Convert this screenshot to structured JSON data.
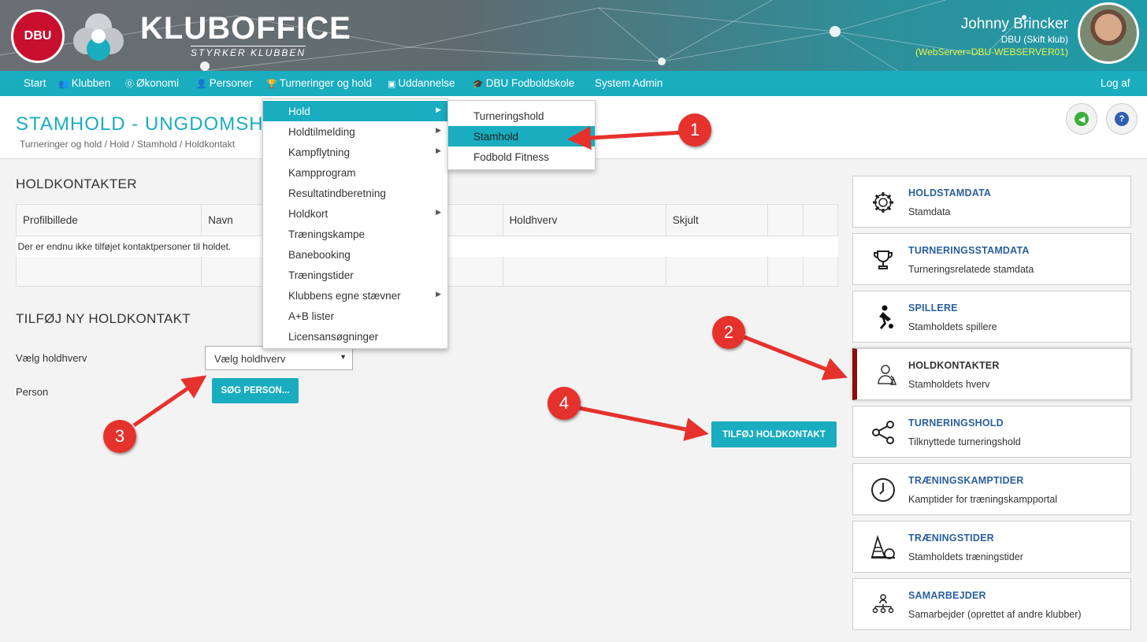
{
  "header": {
    "logo_text": "DBU",
    "brand": "KLUBOFFICE",
    "brand_sub": "STYRKER KLUBBEN",
    "user_name": "Johnny Brincker",
    "user_club": "DBU (Skift klub)",
    "user_server": "(WebServer=DBU-WEBSERVER01)"
  },
  "nav": {
    "items": [
      "Start",
      "Klubben",
      "Økonomi",
      "Personer",
      "Turneringer og hold",
      "Uddannelse",
      "DBU Fodboldskole",
      "System Admin"
    ],
    "logout": "Log af"
  },
  "page": {
    "title": "STAMHOLD - UNGDOMSH",
    "breadcrumb": "Turneringer og hold / Hold / Stamhold / Holdkontakt"
  },
  "holdkontakter": {
    "title": "HOLDKONTAKTER",
    "columns": [
      "Profilbillede",
      "Navn",
      "",
      "Holdhverv",
      "Skjult",
      "",
      ""
    ],
    "empty_message": "Der er endnu ikke tilføjet kontaktpersoner til holdet."
  },
  "add_form": {
    "title": "TILFØJ NY HOLDKONTAKT",
    "role_label": "Vælg holdhverv",
    "role_value": "Vælg holdhverv",
    "person_label": "Person",
    "search_button": "SØG PERSON...",
    "add_button": "TILFØJ HOLDKONTAKT"
  },
  "menu": {
    "items": [
      {
        "label": "Hold",
        "sub": true
      },
      {
        "label": "Holdtilmelding",
        "sub": true
      },
      {
        "label": "Kampflytning",
        "sub": true
      },
      {
        "label": "Kampprogram",
        "sub": false
      },
      {
        "label": "Resultatindberetning",
        "sub": false
      },
      {
        "label": "Holdkort",
        "sub": true
      },
      {
        "label": "Træningskampe",
        "sub": false
      },
      {
        "label": "Banebooking",
        "sub": false
      },
      {
        "label": "Træningstider",
        "sub": false
      },
      {
        "label": "Klubbens egne stævner",
        "sub": true
      },
      {
        "label": "A+B lister",
        "sub": false
      },
      {
        "label": "Licensansøgninger",
        "sub": false
      }
    ],
    "submenu": [
      "Turneringshold",
      "Stamhold",
      "Fodbold Fitness"
    ]
  },
  "cards": [
    {
      "title": "HOLDSTAMDATA",
      "sub": "Stamdata",
      "icon": "gear-icon"
    },
    {
      "title": "TURNERINGSSTAMDATA",
      "sub": "Turneringsrelatede stamdata",
      "icon": "trophy-icon"
    },
    {
      "title": "SPILLERE",
      "sub": "Stamholdets spillere",
      "icon": "player-icon"
    },
    {
      "title": "HOLDKONTAKTER",
      "sub": "Stamholdets hverv",
      "icon": "contact-icon"
    },
    {
      "title": "TURNERINGSHOLD",
      "sub": "Tilknyttede turneringshold",
      "icon": "share-icon"
    },
    {
      "title": "TRÆNINGSKAMPTIDER",
      "sub": "Kamptider for træningskampportal",
      "icon": "clock-icon"
    },
    {
      "title": "TRÆNINGSTIDER",
      "sub": "Stamholdets træningstider",
      "icon": "cone-ball-icon"
    },
    {
      "title": "SAMARBEJDER",
      "sub": "Samarbejder (oprettet af andre klubber)",
      "icon": "org-icon"
    }
  ],
  "annotations": [
    "1",
    "2",
    "3",
    "4"
  ],
  "colors": {
    "teal": "#19adbf",
    "card_title": "#2a5f9e",
    "active_marker": "#8b0d0d",
    "annotation_red": "#e5322d",
    "server_text": "#e8f54a"
  }
}
